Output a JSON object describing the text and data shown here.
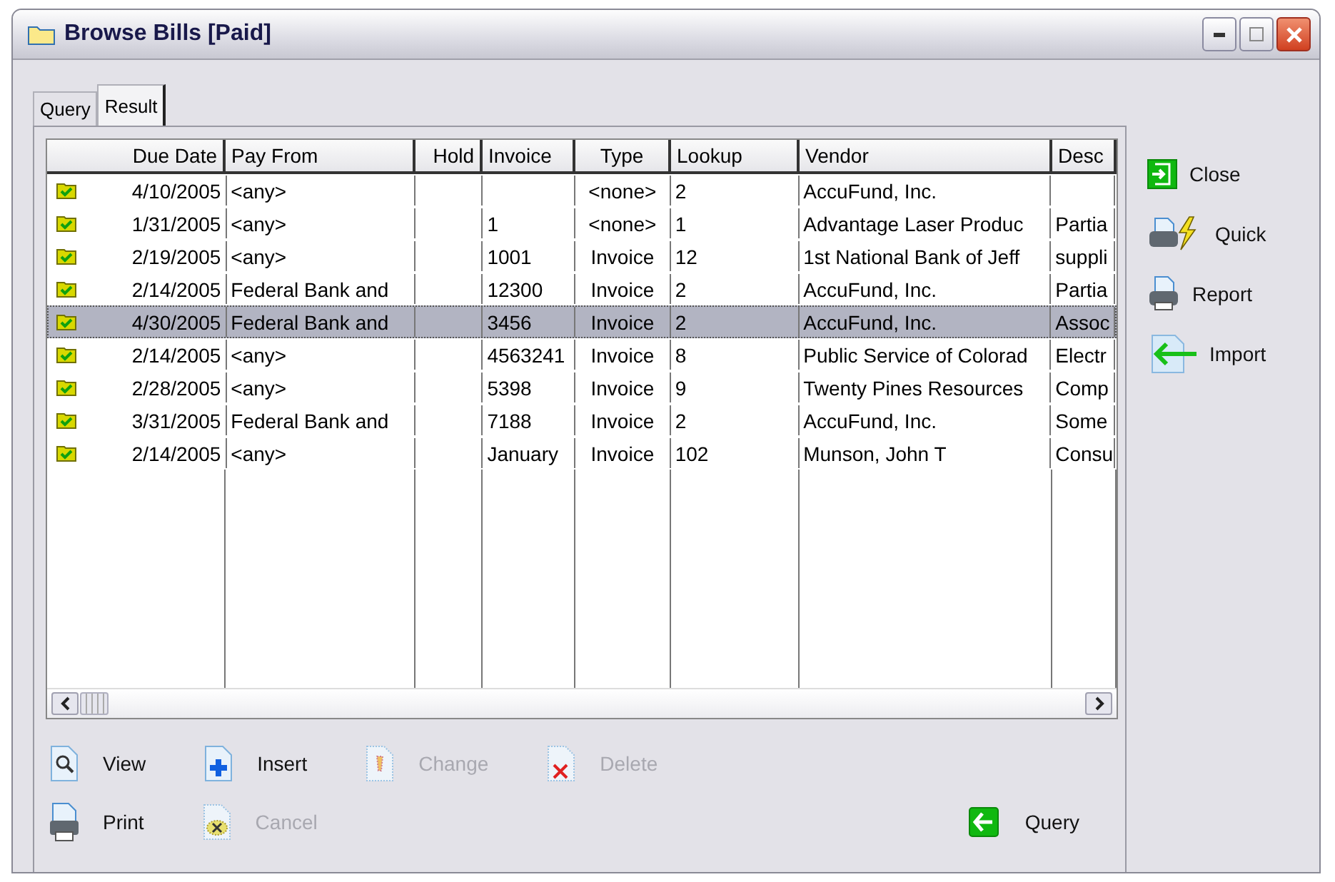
{
  "window": {
    "title": "Browse Bills [Paid]"
  },
  "tabs": [
    {
      "label": "Query",
      "selected": false
    },
    {
      "label": "Result",
      "selected": true
    }
  ],
  "table": {
    "columns": [
      "Due Date",
      "Pay From",
      "Hold",
      "Invoice",
      "Type",
      "Lookup",
      "Vendor",
      "Desc"
    ],
    "rows": [
      {
        "selected": false,
        "cells": [
          "4/10/2005",
          "<any>",
          "",
          "",
          "<none>",
          "2",
          "AccuFund, Inc.",
          ""
        ]
      },
      {
        "selected": false,
        "cells": [
          "1/31/2005",
          "<any>",
          "",
          "1",
          "<none>",
          "1",
          "Advantage Laser Produc",
          "Partia"
        ]
      },
      {
        "selected": false,
        "cells": [
          "2/19/2005",
          "<any>",
          "",
          "1001",
          "Invoice",
          "12",
          "1st National Bank of Jeff",
          "suppli"
        ]
      },
      {
        "selected": false,
        "cells": [
          "2/14/2005",
          "Federal Bank and",
          "",
          "12300",
          "Invoice",
          "2",
          "AccuFund, Inc.",
          "Partia"
        ]
      },
      {
        "selected": true,
        "cells": [
          "4/30/2005",
          "Federal Bank and",
          "",
          "3456",
          "Invoice",
          "2",
          "AccuFund, Inc.",
          "Assoc"
        ]
      },
      {
        "selected": false,
        "cells": [
          "2/14/2005",
          "<any>",
          "",
          "4563241",
          "Invoice",
          "8",
          "Public Service of Colorad",
          "Electr"
        ]
      },
      {
        "selected": false,
        "cells": [
          "2/28/2005",
          "<any>",
          "",
          "5398",
          "Invoice",
          "9",
          "Twenty Pines Resources",
          "Comp"
        ]
      },
      {
        "selected": false,
        "cells": [
          "3/31/2005",
          "Federal Bank and",
          "",
          "7188",
          "Invoice",
          "2",
          "AccuFund, Inc.",
          "Some"
        ]
      },
      {
        "selected": false,
        "cells": [
          "2/14/2005",
          "<any>",
          "",
          "January",
          "Invoice",
          "102",
          "Munson, John T",
          "Consu"
        ]
      }
    ]
  },
  "bottom_buttons": [
    {
      "kind": "view",
      "label": "View",
      "disabled": false
    },
    {
      "kind": "insert",
      "label": "Insert",
      "disabled": false
    },
    {
      "kind": "change",
      "label": "Change",
      "disabled": true
    },
    {
      "kind": "delete",
      "label": "Delete",
      "disabled": true
    },
    {
      "kind": "print",
      "label": "Print",
      "disabled": false
    },
    {
      "kind": "cancel",
      "label": "Cancel",
      "disabled": true
    },
    {
      "kind": "query",
      "label": "Query",
      "disabled": false
    }
  ],
  "side_buttons": [
    {
      "kind": "close",
      "label": "Close"
    },
    {
      "kind": "quick",
      "label": "Quick"
    },
    {
      "kind": "report",
      "label": "Report"
    },
    {
      "kind": "import",
      "label": "Import"
    }
  ]
}
